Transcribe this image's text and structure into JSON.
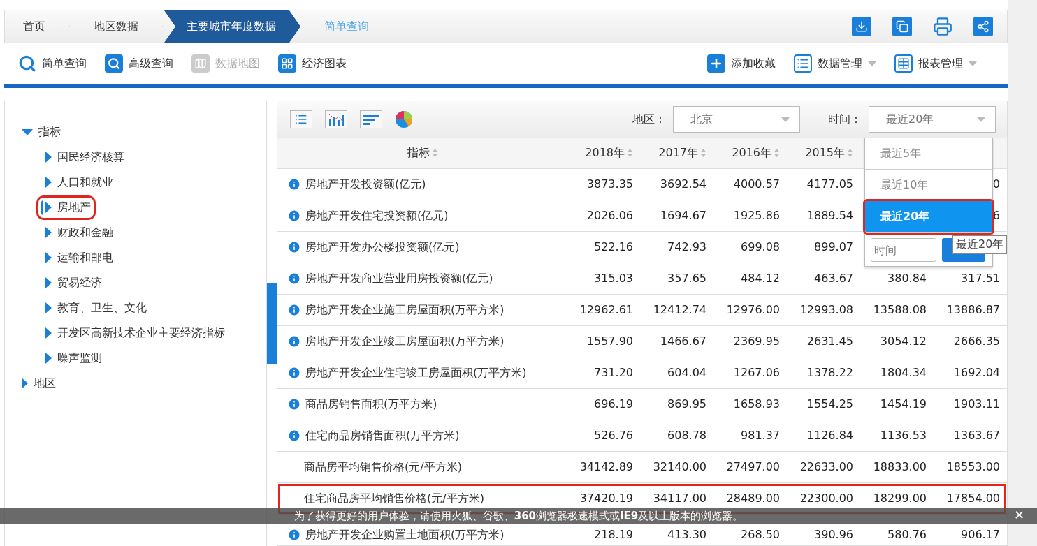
{
  "breadcrumb": [
    {
      "label": "首页",
      "kind": "link"
    },
    {
      "label": "地区数据",
      "kind": "link"
    },
    {
      "label": "主要城市年度数据",
      "kind": "active"
    },
    {
      "label": "简单查询",
      "kind": "current"
    }
  ],
  "toolbar_left": [
    {
      "label": "简单查询",
      "kind": "search",
      "disabled": false
    },
    {
      "label": "高级查询",
      "kind": "advanced",
      "disabled": false
    },
    {
      "label": "数据地图",
      "kind": "map",
      "disabled": true
    },
    {
      "label": "经济图表",
      "kind": "chart",
      "disabled": false
    }
  ],
  "toolbar_right": [
    {
      "label": "添加收藏",
      "kind": "add",
      "has_menu": false
    },
    {
      "label": "数据管理",
      "kind": "manage",
      "has_menu": true
    },
    {
      "label": "报表管理",
      "kind": "report",
      "has_menu": true
    }
  ],
  "tree": [
    {
      "label": "指标",
      "expanded": true,
      "children": [
        {
          "label": "国民经济核算",
          "selected": false
        },
        {
          "label": "人口和就业",
          "selected": false
        },
        {
          "label": "房地产",
          "selected": true
        },
        {
          "label": "财政和金融",
          "selected": false
        },
        {
          "label": "运输和邮电",
          "selected": false
        },
        {
          "label": "贸易经济",
          "selected": false
        },
        {
          "label": "教育、卫生、文化",
          "selected": false
        },
        {
          "label": "开发区高新技术企业主要经济指标",
          "selected": false
        },
        {
          "label": "噪声监测",
          "selected": false
        }
      ]
    },
    {
      "label": "地区",
      "expanded": false
    }
  ],
  "filters": {
    "region_label": "地区：",
    "region_value": "北京",
    "time_label": "时间：",
    "time_value": "最近20年"
  },
  "time_menu": {
    "options": [
      {
        "label": "最近5年",
        "selected": false
      },
      {
        "label": "最近10年",
        "selected": false
      },
      {
        "label": "最近20年",
        "selected": true
      }
    ],
    "placeholder": "时间",
    "tooltip": "最近20年"
  },
  "table": {
    "columns": [
      "指标",
      "2018年",
      "2017年",
      "2016年",
      "2015年",
      null,
      null
    ],
    "rows": [
      {
        "info": true,
        "highlighted": false,
        "cells": [
          "房地产开发投资额(亿元)",
          "3873.35",
          "3692.54",
          "4000.57",
          "4177.05",
          null,
          "0"
        ]
      },
      {
        "info": true,
        "highlighted": false,
        "cells": [
          "房地产开发住宅投资额(亿元)",
          "2026.06",
          "1694.67",
          "1925.86",
          "1889.54",
          null,
          "6"
        ]
      },
      {
        "info": true,
        "highlighted": false,
        "cells": [
          "房地产开发办公楼投资额(亿元)",
          "522.16",
          "742.93",
          "699.08",
          "899.07",
          null,
          null
        ]
      },
      {
        "info": true,
        "highlighted": false,
        "cells": [
          "房地产开发商业营业用房投资额(亿元)",
          "315.03",
          "357.65",
          "484.12",
          "463.67",
          "380.84",
          "317.51"
        ]
      },
      {
        "info": true,
        "highlighted": false,
        "cells": [
          "房地产开发企业施工房屋面积(万平方米)",
          "12962.61",
          "12412.74",
          "12976.00",
          "12993.08",
          "13588.08",
          "13886.87"
        ]
      },
      {
        "info": true,
        "highlighted": false,
        "cells": [
          "房地产开发企业竣工房屋面积(万平方米)",
          "1557.90",
          "1466.67",
          "2369.95",
          "2631.45",
          "3054.12",
          "2666.35"
        ]
      },
      {
        "info": true,
        "highlighted": false,
        "cells": [
          "房地产开发企业住宅竣工房屋面积(万平方米)",
          "731.20",
          "604.04",
          "1267.06",
          "1378.22",
          "1804.34",
          "1692.04"
        ]
      },
      {
        "info": true,
        "highlighted": false,
        "cells": [
          "商品房销售面积(万平方米)",
          "696.19",
          "869.95",
          "1658.93",
          "1554.25",
          "1454.19",
          "1903.11"
        ]
      },
      {
        "info": true,
        "highlighted": false,
        "cells": [
          "住宅商品房销售面积(万平方米)",
          "526.76",
          "608.78",
          "981.37",
          "1126.84",
          "1136.53",
          "1363.67"
        ]
      },
      {
        "info": false,
        "highlighted": false,
        "cells": [
          "商品房平均销售价格(元/平方米)",
          "34142.89",
          "32140.00",
          "27497.00",
          "22633.00",
          "18833.00",
          "18553.00"
        ]
      },
      {
        "info": false,
        "highlighted": true,
        "cells": [
          "住宅商品房平均销售价格(元/平方米)",
          "37420.19",
          "34117.00",
          "28489.00",
          "22300.00",
          "18299.00",
          "17854.00"
        ]
      },
      {
        "info": true,
        "highlighted": false,
        "cells": [
          "房地产开发企业购置土地面积(万平方米)",
          "218.19",
          "413.30",
          "268.50",
          "390.96",
          "580.76",
          "906.17"
        ]
      }
    ]
  },
  "notice": {
    "text": "为了获得更好的用户体验，请使用火狐、谷歌、**360**浏览器极速模式或**IE9**及以上版本的浏览器。",
    "close": "✕"
  }
}
